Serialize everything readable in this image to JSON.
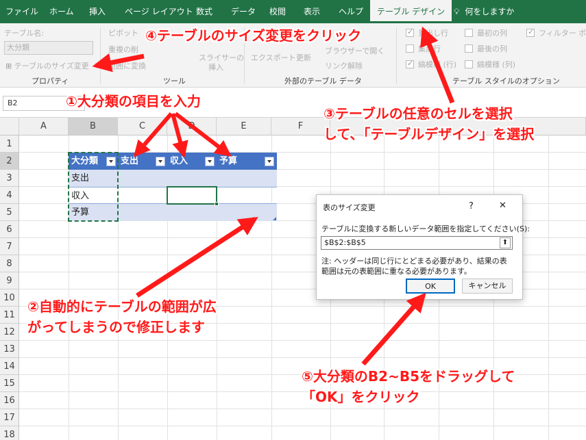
{
  "ribbon_tabs": [
    "ファイル",
    "ホーム",
    "挿入",
    "ページ レイアウト",
    "数式",
    "データ",
    "校閲",
    "表示",
    "ヘルプ",
    "テーブル デザイン"
  ],
  "active_tab": "テーブル デザイン",
  "tell_me": "何をしますか",
  "ribbon": {
    "table_name_label": "テーブル名:",
    "table_name_value": "大分類",
    "resize_table": "テーブルのサイズ変更",
    "group_properties": "プロパティ",
    "pivot": "ピボット",
    "remove_dup": "重複の削",
    "convert_range": "範囲に変換",
    "slicer_1": "スライサーの",
    "slicer_2": "挿入",
    "group_tools": "ツール",
    "export": "エクスポート",
    "refresh": "更新",
    "open_browser": "ブラウザーで開く",
    "unlink": "リンク解除",
    "group_external": "外部のテーブル データ",
    "header_row": "見出し行",
    "total_row": "集計行",
    "banded_rows": "縞模様 (行)",
    "first_col": "最初の列",
    "last_col": "最後の列",
    "banded_cols": "縞模様 (列)",
    "filter_btn": "フィルター ボタン",
    "group_style_options": "テーブル スタイルのオプション"
  },
  "name_box": "B2",
  "columns": [
    "A",
    "B",
    "C",
    "D",
    "E",
    "F"
  ],
  "rows": [
    "1",
    "2",
    "3",
    "4",
    "5",
    "6",
    "7",
    "8",
    "9",
    "10",
    "11",
    "12",
    "13",
    "14",
    "15",
    "16",
    "17",
    "18"
  ],
  "table": {
    "headers": [
      "大分類",
      "支出",
      "収入",
      "予算"
    ],
    "row_labels": [
      "支出",
      "収入",
      "予算"
    ]
  },
  "dialog": {
    "title": "表のサイズ変更",
    "help": "?",
    "close": "✕",
    "prompt": "テーブルに変換する新しいデータ範囲を指定してください(S):",
    "range": "$B$2:$B$5",
    "note_1": "注: ヘッダーは同じ行にとどまる必要があり、結果の表",
    "note_2": "範囲は元の表範囲に重なる必要があります。",
    "ok": "OK",
    "cancel": "キャンセル"
  },
  "annotations": {
    "step1": "①大分類の項目を入力",
    "step2_line1": "②自動的にテーブルの範囲が広",
    "step2_line2": "がってしまうので修正します",
    "step3_line1": "③テーブルの任意のセルを選択",
    "step3_line2": "して、「テーブルデザイン」を選択",
    "step4": "④テーブルのサイズ変更をクリック",
    "step5_line1": "⑤大分類のB2~B5をドラッグして",
    "step5_line2": "「OK」をクリック"
  },
  "colors": {
    "excel_green": "#217346",
    "table_header": "#4472c4",
    "table_band": "#d9e1f2",
    "annotation_red": "#ff1a1a"
  }
}
